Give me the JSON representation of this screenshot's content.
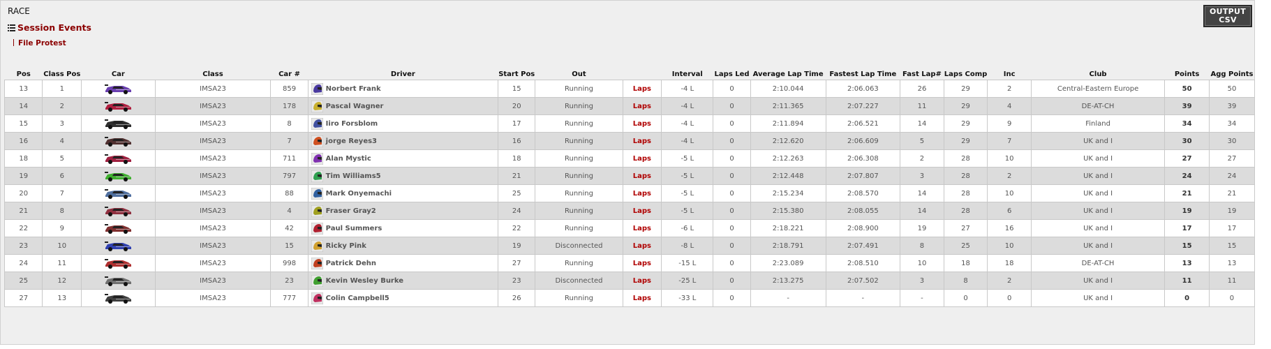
{
  "page": {
    "title": "RACE"
  },
  "session_events": {
    "label": "Session Events",
    "icon": "list-icon"
  },
  "file_protest": {
    "label": "File Protest"
  },
  "output_csv": {
    "line1": "OUTPUT",
    "line2": "CSV"
  },
  "columns": [
    {
      "key": "pos",
      "label": "Pos"
    },
    {
      "key": "class_pos",
      "label": "Class Pos"
    },
    {
      "key": "car",
      "label": "Car"
    },
    {
      "key": "class",
      "label": "Class"
    },
    {
      "key": "car_num",
      "label": "Car #"
    },
    {
      "key": "driver",
      "label": "Driver"
    },
    {
      "key": "start_pos",
      "label": "Start Pos"
    },
    {
      "key": "out",
      "label": "Out"
    },
    {
      "key": "laps_link",
      "label": ""
    },
    {
      "key": "interval",
      "label": "Interval"
    },
    {
      "key": "laps_led",
      "label": "Laps Led"
    },
    {
      "key": "avg_lap",
      "label": "Average Lap Time"
    },
    {
      "key": "fastest_lap",
      "label": "Fastest Lap Time"
    },
    {
      "key": "fast_lap_num",
      "label": "Fast Lap#"
    },
    {
      "key": "laps_comp",
      "label": "Laps Comp"
    },
    {
      "key": "inc",
      "label": "Inc"
    },
    {
      "key": "club",
      "label": "Club"
    },
    {
      "key": "points",
      "label": "Points"
    },
    {
      "key": "agg_points",
      "label": "Agg Points"
    }
  ],
  "colors": {
    "accent_red": "#8b0000",
    "laps_red": "#b00000",
    "row_alt": "#dcdcdc"
  },
  "rows": [
    {
      "pos": "13",
      "class_pos": "1",
      "class": "IMSA23",
      "car_num": "859",
      "driver": "Norbert Frank",
      "start_pos": "15",
      "out": "Running",
      "laps_link": "Laps",
      "interval": "-4 L",
      "laps_led": "0",
      "avg_lap": "2:10.044",
      "fastest_lap": "2:06.063",
      "fast_lap_num": "26",
      "laps_comp": "29",
      "inc": "2",
      "club": "Central-Eastern Europe",
      "points": "50",
      "agg_points": "50",
      "car_color": "#6a3fb0",
      "helmet_color": "#4a3aa0"
    },
    {
      "pos": "14",
      "class_pos": "2",
      "class": "IMSA23",
      "car_num": "178",
      "driver": "Pascal Wagner",
      "start_pos": "20",
      "out": "Running",
      "laps_link": "Laps",
      "interval": "-4 L",
      "laps_led": "0",
      "avg_lap": "2:11.365",
      "fastest_lap": "2:07.227",
      "fast_lap_num": "11",
      "laps_comp": "29",
      "inc": "4",
      "club": "DE-AT-CH",
      "points": "39",
      "agg_points": "39",
      "car_color": "#b02040",
      "helmet_color": "#c8b030"
    },
    {
      "pos": "15",
      "class_pos": "3",
      "class": "IMSA23",
      "car_num": "8",
      "driver": "Iiro Forsblom",
      "start_pos": "17",
      "out": "Running",
      "laps_link": "Laps",
      "interval": "-4 L",
      "laps_led": "0",
      "avg_lap": "2:11.894",
      "fastest_lap": "2:06.521",
      "fast_lap_num": "14",
      "laps_comp": "29",
      "inc": "9",
      "club": "Finland",
      "points": "34",
      "agg_points": "34",
      "car_color": "#303030",
      "helmet_color": "#4050a0"
    },
    {
      "pos": "16",
      "class_pos": "4",
      "class": "IMSA23",
      "car_num": "7",
      "driver": "jorge Reyes3",
      "start_pos": "16",
      "out": "Running",
      "laps_link": "Laps",
      "interval": "-4 L",
      "laps_led": "0",
      "avg_lap": "2:12.620",
      "fastest_lap": "2:06.609",
      "fast_lap_num": "5",
      "laps_comp": "29",
      "inc": "7",
      "club": "UK and I",
      "points": "30",
      "agg_points": "30",
      "car_color": "#503030",
      "helmet_color": "#d05020"
    },
    {
      "pos": "18",
      "class_pos": "5",
      "class": "IMSA23",
      "car_num": "711",
      "driver": "Alan Mystic",
      "start_pos": "18",
      "out": "Running",
      "laps_link": "Laps",
      "interval": "-5 L",
      "laps_led": "0",
      "avg_lap": "2:12.263",
      "fastest_lap": "2:06.308",
      "fast_lap_num": "2",
      "laps_comp": "28",
      "inc": "10",
      "club": "UK and I",
      "points": "27",
      "agg_points": "27",
      "car_color": "#a02040",
      "helmet_color": "#8030b0"
    },
    {
      "pos": "19",
      "class_pos": "6",
      "class": "IMSA23",
      "car_num": "797",
      "driver": "Tim Williams5",
      "start_pos": "21",
      "out": "Running",
      "laps_link": "Laps",
      "interval": "-5 L",
      "laps_led": "0",
      "avg_lap": "2:12.448",
      "fastest_lap": "2:07.807",
      "fast_lap_num": "3",
      "laps_comp": "28",
      "inc": "2",
      "club": "UK and I",
      "points": "24",
      "agg_points": "24",
      "car_color": "#40b030",
      "helmet_color": "#30a050"
    },
    {
      "pos": "20",
      "class_pos": "7",
      "class": "IMSA23",
      "car_num": "88",
      "driver": "Mark Onyemachi",
      "start_pos": "25",
      "out": "Running",
      "laps_link": "Laps",
      "interval": "-5 L",
      "laps_led": "0",
      "avg_lap": "2:15.234",
      "fastest_lap": "2:08.570",
      "fast_lap_num": "14",
      "laps_comp": "28",
      "inc": "10",
      "club": "UK and I",
      "points": "21",
      "agg_points": "21",
      "car_color": "#5070a0",
      "helmet_color": "#3060a0"
    },
    {
      "pos": "21",
      "class_pos": "8",
      "class": "IMSA23",
      "car_num": "4",
      "driver": "Fraser Gray2",
      "start_pos": "24",
      "out": "Running",
      "laps_link": "Laps",
      "interval": "-5 L",
      "laps_led": "0",
      "avg_lap": "2:15.380",
      "fastest_lap": "2:08.055",
      "fast_lap_num": "14",
      "laps_comp": "28",
      "inc": "6",
      "club": "UK and I",
      "points": "19",
      "agg_points": "19",
      "car_color": "#903040",
      "helmet_color": "#a0a020"
    },
    {
      "pos": "22",
      "class_pos": "9",
      "class": "IMSA23",
      "car_num": "42",
      "driver": "Paul Summers",
      "start_pos": "22",
      "out": "Running",
      "laps_link": "Laps",
      "interval": "-6 L",
      "laps_led": "0",
      "avg_lap": "2:18.221",
      "fastest_lap": "2:08.900",
      "fast_lap_num": "19",
      "laps_comp": "27",
      "inc": "16",
      "club": "UK and I",
      "points": "17",
      "agg_points": "17",
      "car_color": "#803030",
      "helmet_color": "#b02030"
    },
    {
      "pos": "23",
      "class_pos": "10",
      "class": "IMSA23",
      "car_num": "15",
      "driver": "Ricky Pink",
      "start_pos": "19",
      "out": "Disconnected",
      "laps_link": "Laps",
      "interval": "-8 L",
      "laps_led": "0",
      "avg_lap": "2:18.791",
      "fastest_lap": "2:07.491",
      "fast_lap_num": "8",
      "laps_comp": "25",
      "inc": "10",
      "club": "UK and I",
      "points": "15",
      "agg_points": "15",
      "car_color": "#3040b0",
      "helmet_color": "#d0a030"
    },
    {
      "pos": "24",
      "class_pos": "11",
      "class": "IMSA23",
      "car_num": "998",
      "driver": "Patrick Dehn",
      "start_pos": "27",
      "out": "Running",
      "laps_link": "Laps",
      "interval": "-15 L",
      "laps_led": "0",
      "avg_lap": "2:23.089",
      "fastest_lap": "2:08.510",
      "fast_lap_num": "10",
      "laps_comp": "18",
      "inc": "18",
      "club": "DE-AT-CH",
      "points": "13",
      "agg_points": "13",
      "car_color": "#b03030",
      "helmet_color": "#c04020"
    },
    {
      "pos": "25",
      "class_pos": "12",
      "class": "IMSA23",
      "car_num": "23",
      "driver": "Kevin Wesley Burke",
      "start_pos": "23",
      "out": "Disconnected",
      "laps_link": "Laps",
      "interval": "-25 L",
      "laps_led": "0",
      "avg_lap": "2:13.275",
      "fastest_lap": "2:07.502",
      "fast_lap_num": "3",
      "laps_comp": "8",
      "inc": "2",
      "club": "UK and I",
      "points": "11",
      "agg_points": "11",
      "car_color": "#707070",
      "helmet_color": "#40a030"
    },
    {
      "pos": "27",
      "class_pos": "13",
      "class": "IMSA23",
      "car_num": "777",
      "driver": "Colin Campbell5",
      "start_pos": "26",
      "out": "Running",
      "laps_link": "Laps",
      "interval": "-33 L",
      "laps_led": "0",
      "avg_lap": "-",
      "fastest_lap": "-",
      "fast_lap_num": "-",
      "laps_comp": "0",
      "inc": "0",
      "club": "UK and I",
      "points": "0",
      "agg_points": "0",
      "car_color": "#404040",
      "helmet_color": "#c03060"
    }
  ]
}
